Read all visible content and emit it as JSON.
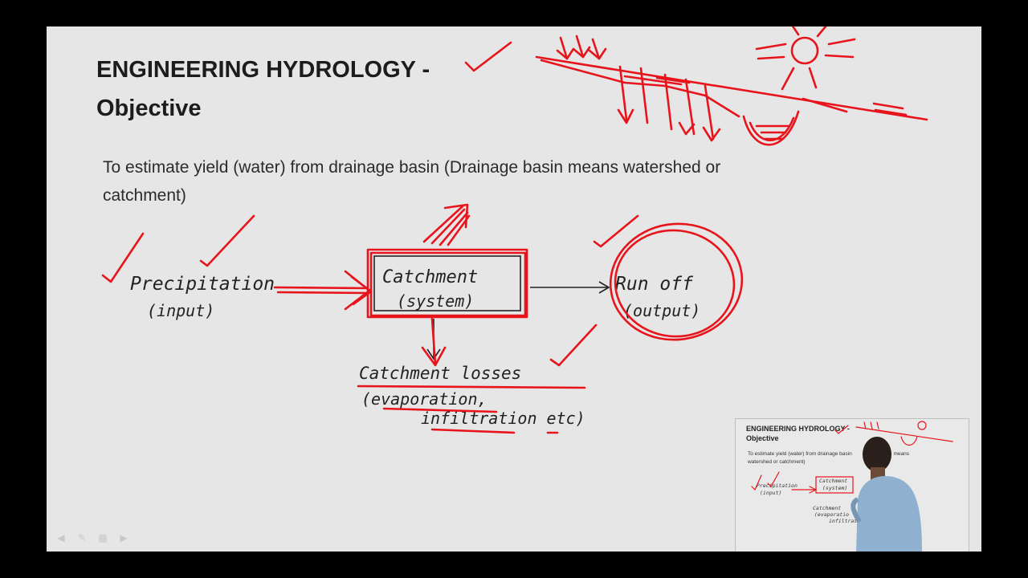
{
  "slide": {
    "title_line1": "ENGINEERING HYDROLOGY -",
    "title_line2": "Objective",
    "description": "To estimate yield (water) from drainage basin (Drainage basin means watershed or catchment)"
  },
  "diagram": {
    "input_label": "Precipitation",
    "input_sub": "(input)",
    "system_label": "Catchment",
    "system_sub": "(system)",
    "output_label": "Run off",
    "output_sub": "(output)",
    "losses_label": "Catchment losses",
    "losses_sub1": "(evaporation,",
    "losses_sub2": "infiltration etc)"
  },
  "annotation_color": "#e8141c",
  "toolbar": {
    "icons": [
      "pointer-icon",
      "pen-icon",
      "slides-icon",
      "next-icon"
    ]
  },
  "video_inset": {
    "title_line1": "ENGINEERING HYDROLOGY -",
    "title_line2": "Objective",
    "description": "To estimate yield (water) from drainage basin",
    "description_tail": "means",
    "description_line2": "watershed or catchment)",
    "input_label": "Precipitation",
    "input_sub": "(input)",
    "system_label": "Catchment",
    "system_sub": "(system)",
    "losses_label": "Catchment",
    "losses_sub1": "(evaporatio",
    "losses_sub2": "infiltratio"
  }
}
